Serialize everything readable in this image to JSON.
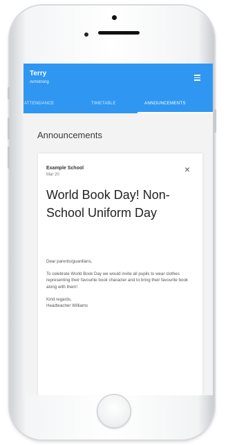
{
  "header": {
    "user_name": "Terry",
    "user_subtitle": "Armstrong"
  },
  "tabs": [
    {
      "label": "ATTENDANCE"
    },
    {
      "label": "TIMETABLE"
    },
    {
      "label": "ANNOUNCEMENTS"
    }
  ],
  "main": {
    "section_title": "Announcements",
    "card": {
      "school": "Example School",
      "date": "Mar 20",
      "close_glyph": "×",
      "headline": "World Book Day! Non-School Uniform Day",
      "greeting": "Dear parents/guardians,",
      "body": "To celebrate World Book Day we would invite all pupils to wear clothes representing their favourite book character and to bring their favourite book along with them!",
      "signoff": "Kind regards,",
      "signature": "Headteacher Williams"
    }
  },
  "colors": {
    "appbar": "#2f97f1"
  },
  "icons": {
    "menu": "menu-icon",
    "close": "close-icon"
  }
}
